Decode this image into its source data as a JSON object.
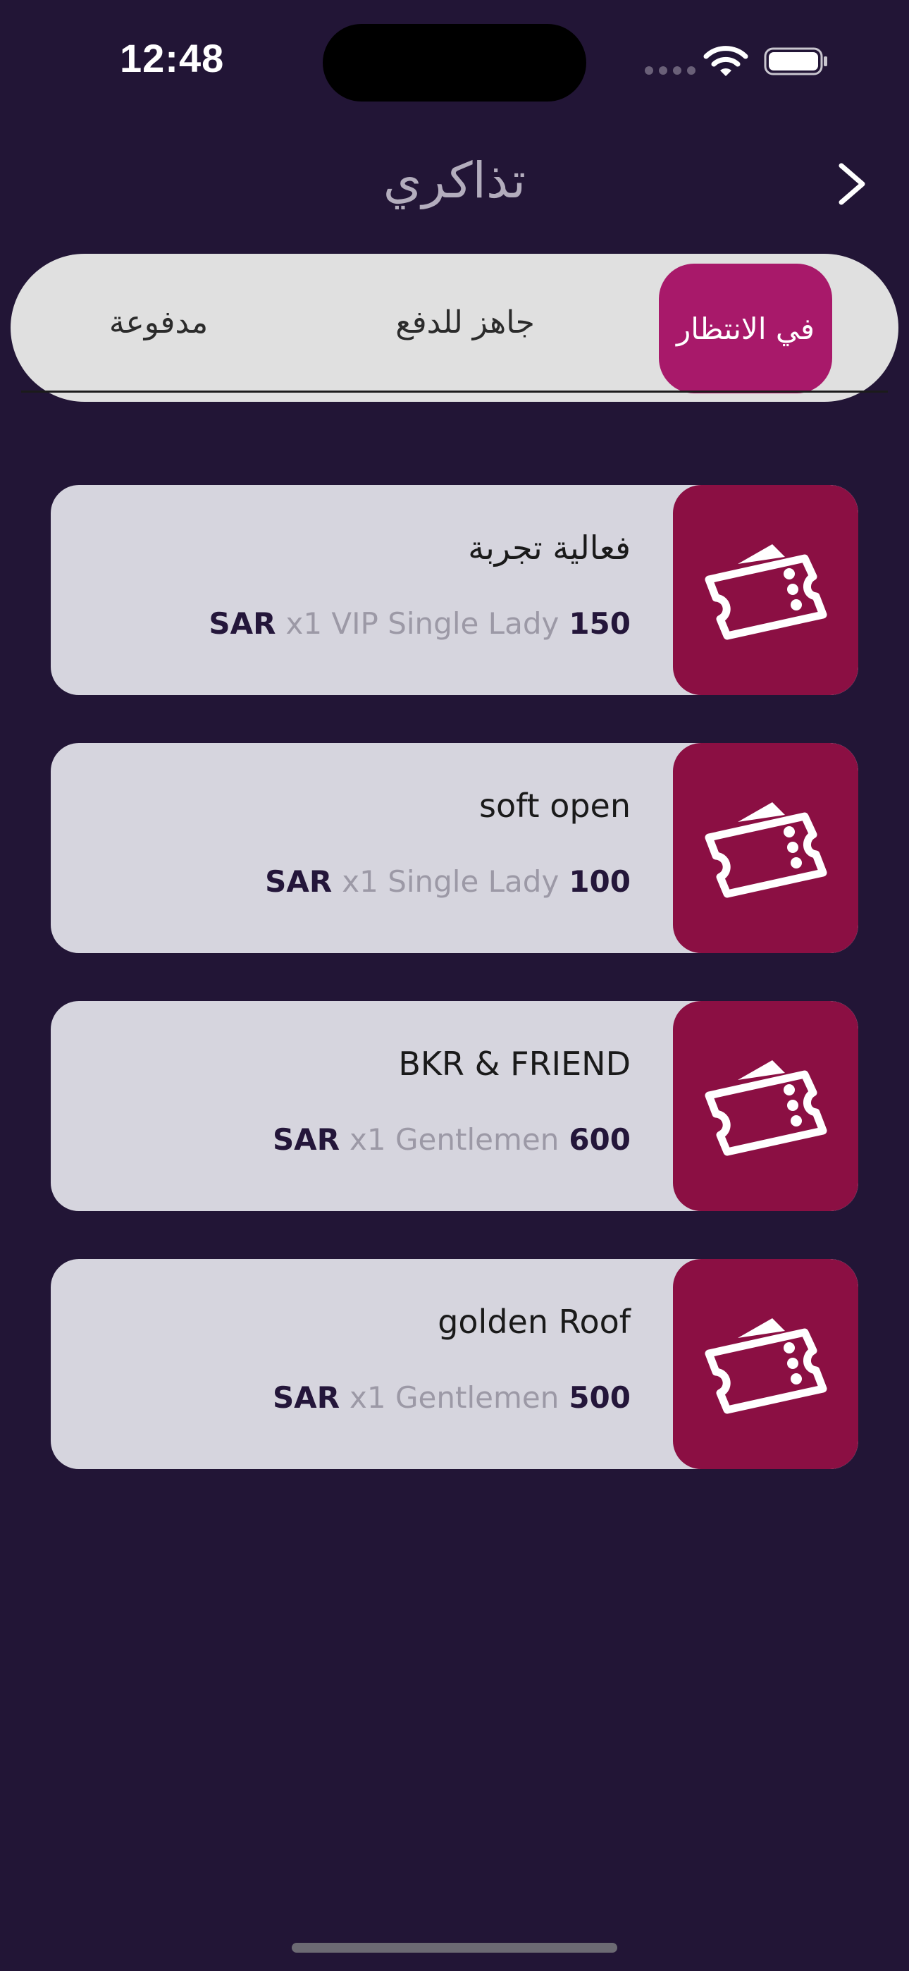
{
  "status_bar": {
    "time": "12:48"
  },
  "header": {
    "title": "تذاكري"
  },
  "tabs": [
    {
      "label": "مدفوعة"
    },
    {
      "label": "جاهز للدفع"
    },
    {
      "label": "في الانتظار",
      "selected": true
    }
  ],
  "tickets": [
    {
      "name": "فعالية تجربة",
      "currency": "SAR",
      "description": "x1 VIP Single Lady",
      "price": "150"
    },
    {
      "name": "soft open",
      "currency": "SAR",
      "description": "x1 Single Lady",
      "price": "100"
    },
    {
      "name": "BKR & FRIEND",
      "currency": "SAR",
      "description": "x1 Gentlemen",
      "price": "600"
    },
    {
      "name": "golden Roof",
      "currency": "SAR",
      "description": "x1 Gentlemen",
      "price": "500"
    }
  ],
  "colors": {
    "background": "#221536",
    "accent_tab": "#a8196a",
    "ticket_icon_bg": "#8b0f43",
    "card_bg": "#d6d5de"
  }
}
